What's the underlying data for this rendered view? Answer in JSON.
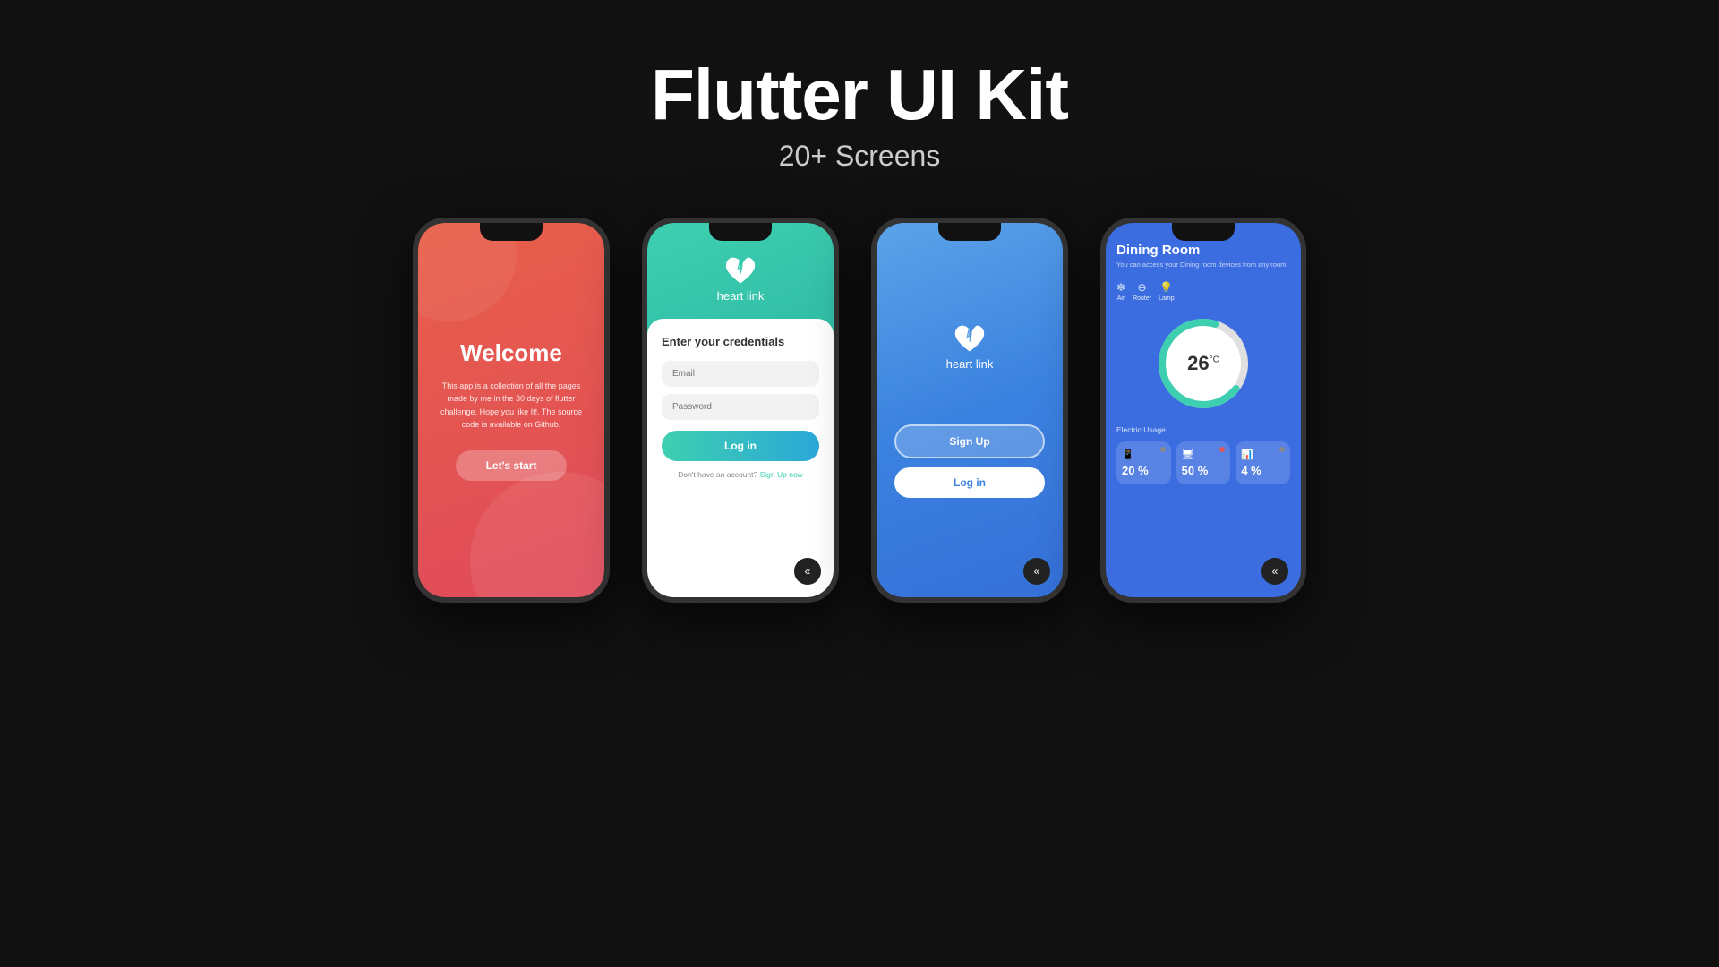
{
  "header": {
    "title": "Flutter UI Kit",
    "subtitle": "20+ Screens"
  },
  "phones": [
    {
      "id": "welcome",
      "welcome_title": "Welcome",
      "welcome_desc": "This app is a collection of all the pages made by me in the 30 days of flutter challenge. Hope you like It!. The source code is available on Github.",
      "btn_start": "Let's start"
    },
    {
      "id": "login",
      "app_name_bold": "heart",
      "app_name_light": " link",
      "card_title": "Enter your credentials",
      "email_placeholder": "Email",
      "password_placeholder": "Password",
      "btn_login": "Log in",
      "signup_text": "Don't have an account?",
      "signup_link": "Sign Up now"
    },
    {
      "id": "signup",
      "app_name_bold": "heart",
      "app_name_light": " link",
      "btn_signup": "Sign Up",
      "btn_login": "Log in"
    },
    {
      "id": "smarthome",
      "room_title": "Dining Room",
      "room_desc": "You can access your Dining room devices from any room.",
      "devices": [
        {
          "name": "Air",
          "icon": "❄"
        },
        {
          "name": "Router",
          "icon": "⊕"
        },
        {
          "name": "Lamp",
          "icon": "💡"
        }
      ],
      "temp_value": "26",
      "temp_unit": "°C",
      "electric_label": "Electric Usage",
      "usage": [
        {
          "icon": "📱",
          "percent": "20 %",
          "dot_color": "#888"
        },
        {
          "icon": "🖥",
          "percent": "50 %",
          "dot_color": "#e05555"
        },
        {
          "icon": "📊",
          "percent": "4 %",
          "dot_color": "#888"
        }
      ]
    }
  ]
}
